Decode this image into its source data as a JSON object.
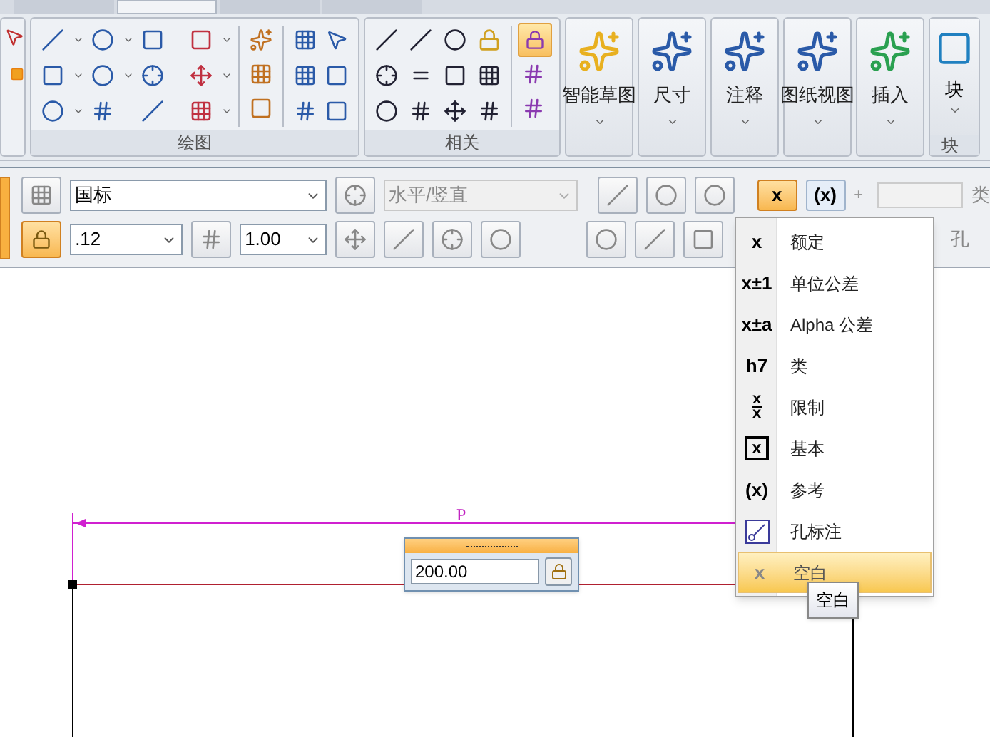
{
  "ribbon": {
    "tabs": [
      {
        "selected": false
      },
      {
        "selected": true
      },
      {
        "selected": false
      },
      {
        "selected": false
      }
    ],
    "groups": [
      {
        "label": "绘图"
      },
      {
        "label": "相关"
      }
    ],
    "large_buttons": [
      {
        "label": "智能草图"
      },
      {
        "label": "尺寸"
      },
      {
        "label": "注释"
      },
      {
        "label": "图纸视图"
      },
      {
        "label": "插入"
      },
      {
        "label": "块"
      }
    ],
    "cut_group_label": "块"
  },
  "command_bar": {
    "style_select": {
      "value": "国标"
    },
    "orientation_select": {
      "value": "水平/竖直",
      "disabled": true
    },
    "precision_select": {
      "value": ".12"
    },
    "scale_select": {
      "value": "1.00"
    },
    "lock": {
      "selected": true
    },
    "tolerance_buttons": [
      {
        "symbol": "x",
        "selected": true
      },
      {
        "symbol": "(x)",
        "selected": false
      }
    ],
    "plus": "+",
    "right_labels": [
      "类",
      "孔"
    ]
  },
  "tolerance_menu": {
    "items": [
      {
        "kind": "plain",
        "symbol": "x",
        "label": "额定",
        "selected": false
      },
      {
        "kind": "plain",
        "symbol": "x±1",
        "label": "单位公差",
        "selected": false
      },
      {
        "kind": "plain",
        "symbol": "x±a",
        "label": "Alpha 公差",
        "selected": false
      },
      {
        "kind": "plain",
        "symbol": "h7",
        "label": "类",
        "selected": false
      },
      {
        "kind": "fraction",
        "symbol": "x",
        "symbol_bottom": "x",
        "label": "限制",
        "selected": false
      },
      {
        "kind": "boxed",
        "symbol": "x",
        "label": "基本",
        "selected": false
      },
      {
        "kind": "plain",
        "symbol": "(x)",
        "label": "参考",
        "selected": false
      },
      {
        "kind": "icon",
        "label": "孔标注",
        "selected": false
      },
      {
        "kind": "plain",
        "symbol": "x",
        "label": "空白",
        "selected": true
      }
    ]
  },
  "tooltip": "空白",
  "canvas": {
    "dimension_label": "P",
    "dimension_input": {
      "value": "200.00"
    }
  }
}
